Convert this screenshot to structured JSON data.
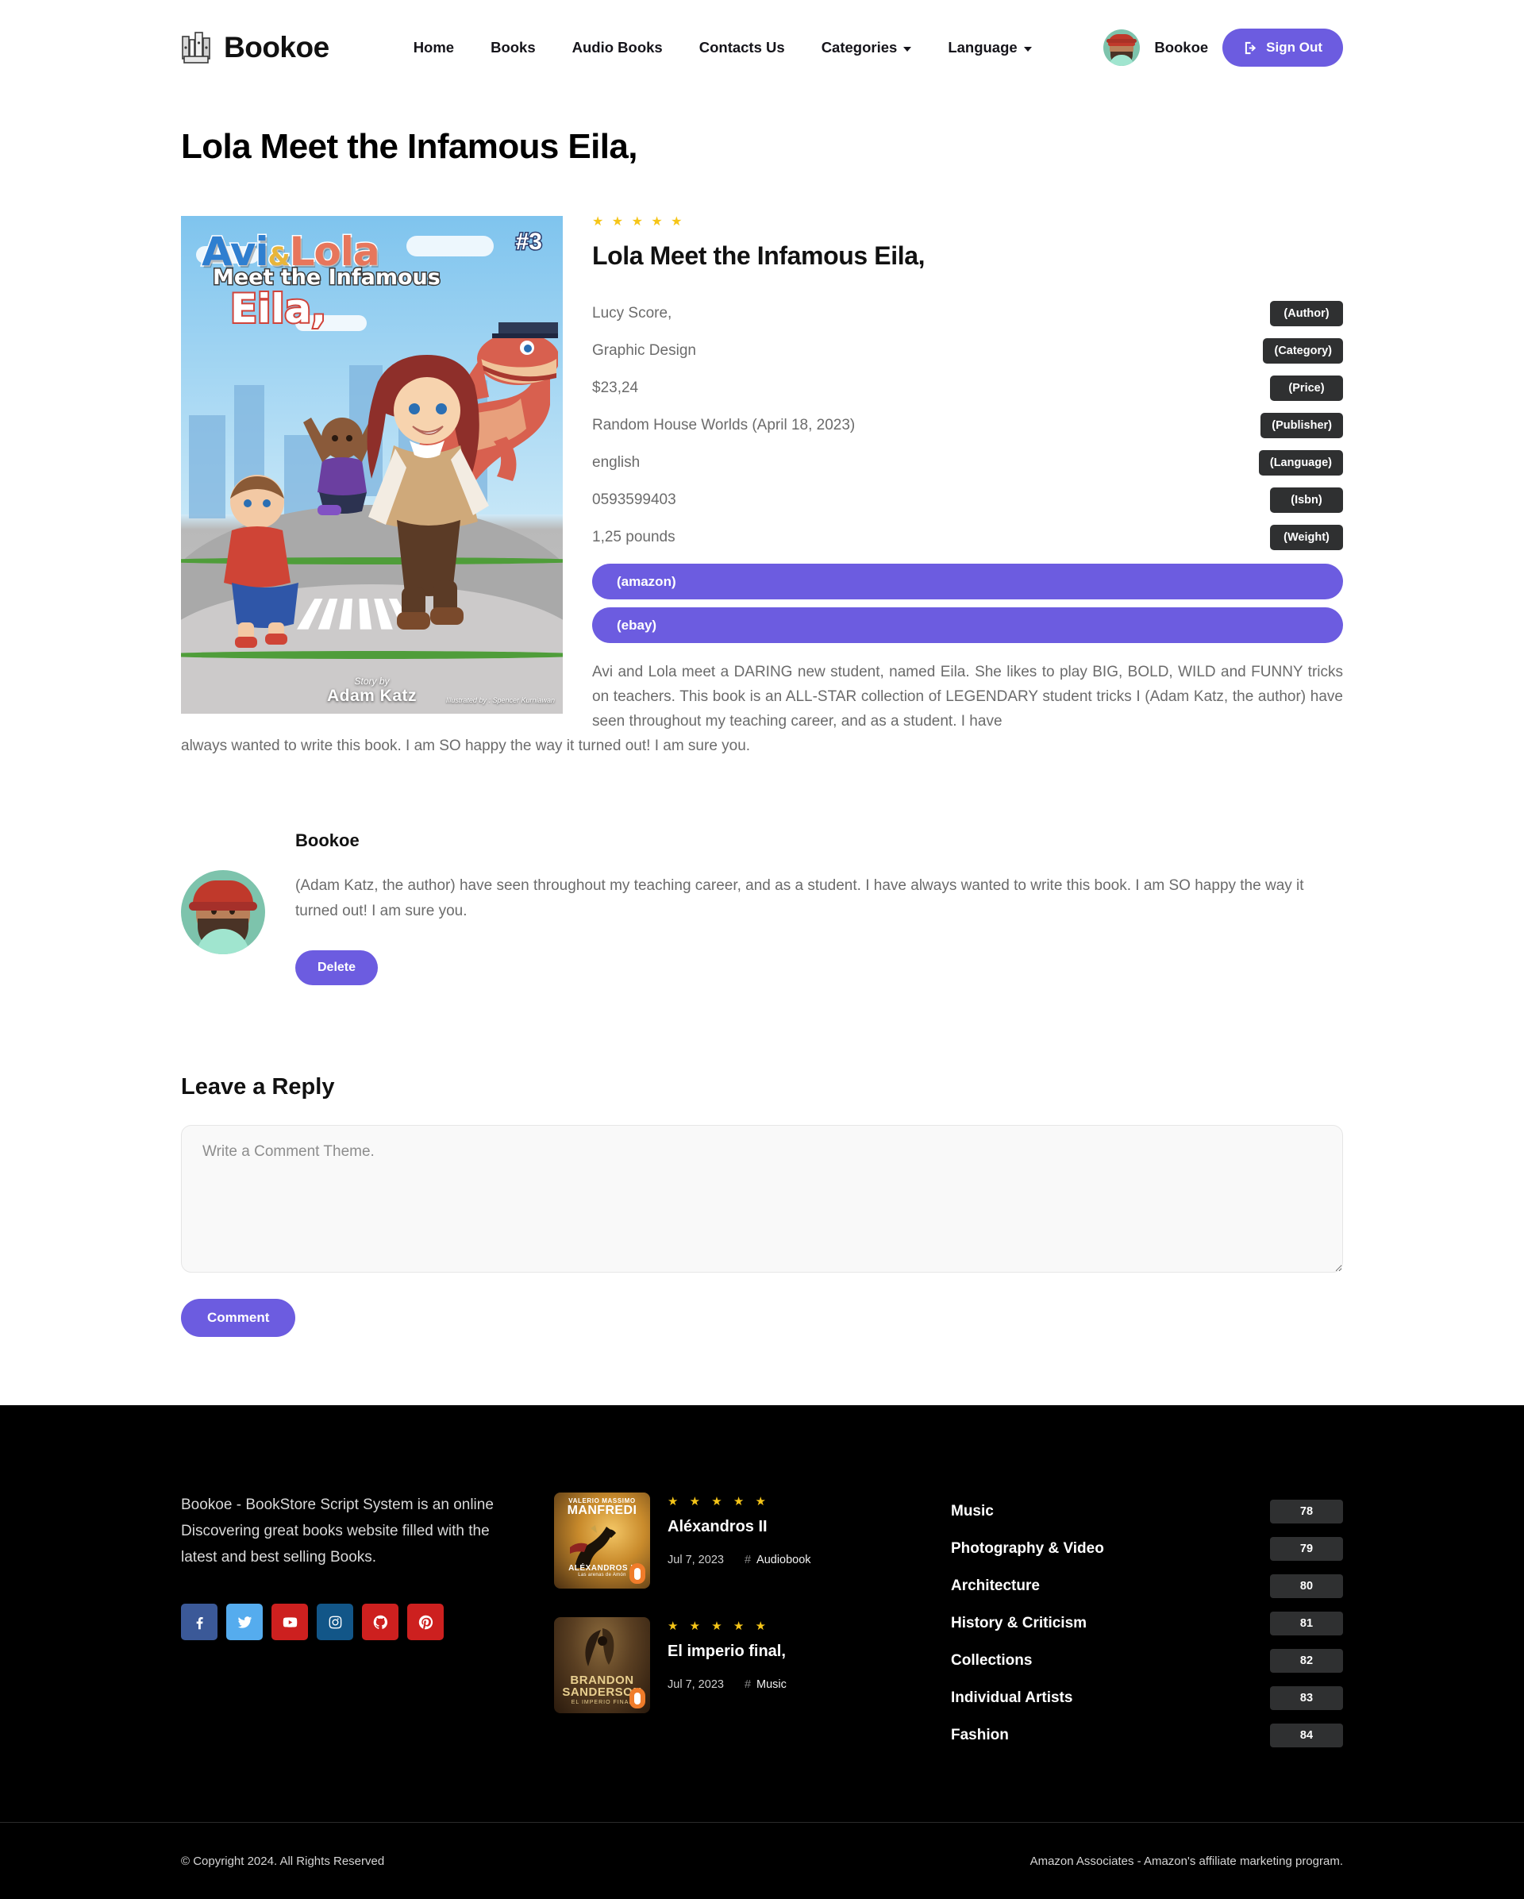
{
  "header": {
    "brand": "Bookoe",
    "brand_icon": "books-stack-icon",
    "nav": [
      {
        "label": "Home",
        "dropdown": false
      },
      {
        "label": "Books",
        "dropdown": false
      },
      {
        "label": "Audio Books",
        "dropdown": false
      },
      {
        "label": "Contacts Us",
        "dropdown": false
      },
      {
        "label": "Categories",
        "dropdown": true
      },
      {
        "label": "Language",
        "dropdown": true
      }
    ],
    "user_name": "Bookoe",
    "sign_out_label": "Sign Out",
    "sign_out_icon": "sign-out-icon",
    "accent_color": "#6c5ce0"
  },
  "page": {
    "title": "Lola Meet the Infamous Eila,"
  },
  "book": {
    "cover": {
      "title_line1": "Avi",
      "title_amp": "&",
      "title_line1b": "Lola",
      "title_line2": "Meet the Infamous",
      "title_line3": "Eila,",
      "issue": "#3",
      "story_by_label": "Story by",
      "story_by": "Adam Katz",
      "illustrated_by": "Illustrated by : Spencer Kurniawan"
    },
    "rating": 5,
    "rating_stars": "★ ★ ★ ★ ★",
    "title": "Lola Meet the Infamous Eila,",
    "meta": [
      {
        "value": "Lucy Score,",
        "badge": "(Author)"
      },
      {
        "value": "Graphic Design",
        "badge": "(Category)"
      },
      {
        "value": "$23,24",
        "badge": "(Price)"
      },
      {
        "value": "Random House Worlds (April 18, 2023)",
        "badge": "(Publisher)"
      },
      {
        "value": "english",
        "badge": "(Language)"
      },
      {
        "value": "0593599403",
        "badge": "(Isbn)"
      },
      {
        "value": "1,25 pounds",
        "badge": "(Weight)"
      }
    ],
    "store_buttons": [
      {
        "label": "(amazon)"
      },
      {
        "label": "(ebay)"
      }
    ],
    "description": "Avi and Lola meet a DARING new student, named Eila. She likes to play BIG, BOLD, WILD and FUNNY tricks on teachers. This book is an ALL-STAR collection of LEGENDARY student tricks I (Adam Katz, the author) have seen throughout my teaching career, and as a student. I have",
    "description_tail": "always wanted to write this book. I am SO happy the way it turned out! I am sure you."
  },
  "review": {
    "author": "Bookoe",
    "text": "(Adam Katz, the author) have seen throughout my teaching career, and as a student. I have always wanted to write this book. I am SO happy the way it turned out! I am sure you.",
    "delete_label": "Delete"
  },
  "reply": {
    "title": "Leave a Reply",
    "placeholder": "Write a Comment Theme.",
    "value": "",
    "submit_label": "Comment"
  },
  "footer": {
    "about": "Bookoe - BookStore Script System is an online Discovering great books website filled with the latest and best selling Books.",
    "socials": [
      {
        "name": "facebook-icon",
        "color": "#3b5998"
      },
      {
        "name": "twitter-icon",
        "color": "#55acee"
      },
      {
        "name": "youtube-icon",
        "color": "#cd201f"
      },
      {
        "name": "instagram-icon",
        "color": "#125688"
      },
      {
        "name": "github-icon",
        "color": "#cd201f"
      },
      {
        "name": "pinterest-icon",
        "color": "#cd201f"
      }
    ],
    "books": [
      {
        "cover_style": "alexandros",
        "cover_author_small": "VALERIO MASSIMO",
        "cover_author_big": "MANFREDI",
        "cover_title": "ALÉXANDROS II",
        "cover_subtitle": "Las arenas de Amón",
        "stars": "★ ★ ★ ★ ★",
        "title": "Aléxandros II",
        "date": "Jul 7, 2023",
        "tag": "Audiobook"
      },
      {
        "cover_style": "imperio",
        "cover_author_line1": "BRANDON",
        "cover_author_line2": "SANDERSON",
        "cover_title": "EL IMPERIO FINAL",
        "stars": "★ ★ ★ ★ ★",
        "title": "El imperio final,",
        "date": "Jul 7, 2023",
        "tag": "Music"
      }
    ],
    "categories": [
      {
        "name": "Music",
        "count": "78"
      },
      {
        "name": "Photography & Video",
        "count": "79"
      },
      {
        "name": "Architecture",
        "count": "80"
      },
      {
        "name": "History & Criticism",
        "count": "81"
      },
      {
        "name": "Collections",
        "count": "82"
      },
      {
        "name": "Individual Artists",
        "count": "83"
      },
      {
        "name": "Fashion",
        "count": "84"
      }
    ],
    "copyright": "© Copyright 2024. All Rights Reserved",
    "affiliate": "Amazon Associates - Amazon's affiliate marketing program."
  }
}
